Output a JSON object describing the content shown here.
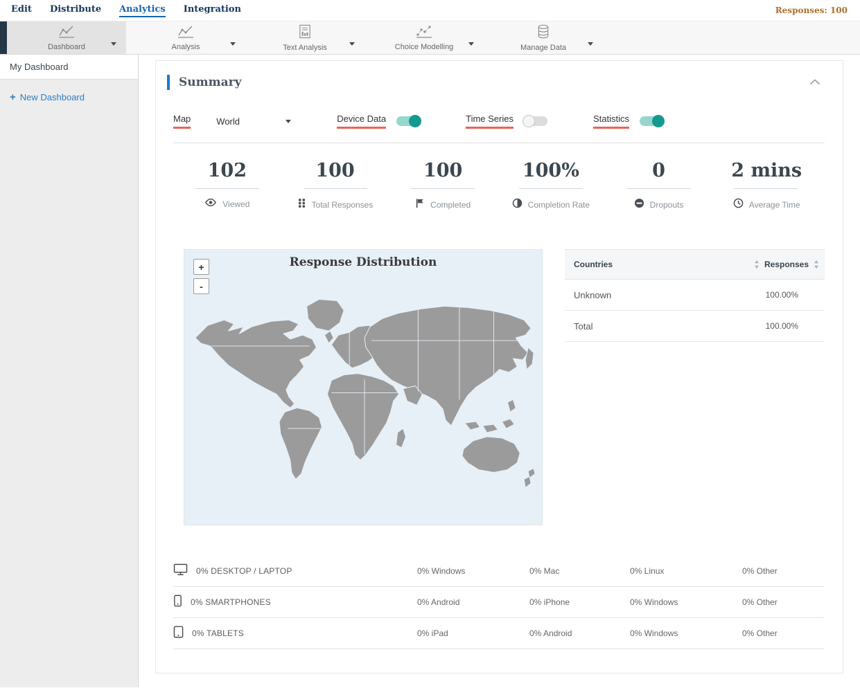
{
  "navbar": {
    "items": [
      {
        "label": "Edit",
        "active": false
      },
      {
        "label": "Distribute",
        "active": false
      },
      {
        "label": "Analytics",
        "active": true
      },
      {
        "label": "Integration",
        "active": false
      }
    ],
    "responses_label": "Responses: 100"
  },
  "toolbar": {
    "items": [
      {
        "label": "Dashboard",
        "icon": "dashboard-chart-icon",
        "active": true
      },
      {
        "label": "Analysis",
        "icon": "analysis-chart-icon",
        "active": false
      },
      {
        "label": "Text Analysis",
        "icon": "text-analysis-icon",
        "active": false
      },
      {
        "label": "Choice Modelling",
        "icon": "choice-modelling-icon",
        "active": false
      },
      {
        "label": "Manage Data",
        "icon": "database-icon",
        "active": false
      }
    ]
  },
  "sidebar": {
    "items": [
      {
        "label": "My Dashboard",
        "active": true
      }
    ],
    "new_dashboard": {
      "plus": "+",
      "label": "New Dashboard"
    }
  },
  "summary": {
    "title": "Summary",
    "controls": {
      "map": {
        "label": "Map",
        "value": "World"
      },
      "device_data": {
        "label": "Device Data",
        "on": true
      },
      "time_series": {
        "label": "Time Series",
        "on": false
      },
      "statistics": {
        "label": "Statistics",
        "on": true
      }
    },
    "stats": [
      {
        "value": "102",
        "label": "Viewed",
        "icon": "eye-icon"
      },
      {
        "value": "100",
        "label": "Total Responses",
        "icon": "grid-dots-icon"
      },
      {
        "value": "100",
        "label": "Completed",
        "icon": "flag-icon"
      },
      {
        "value": "100%",
        "label": "Completion Rate",
        "icon": "half-circle-icon"
      },
      {
        "value": "0",
        "label": "Dropouts",
        "icon": "minus-circle-icon"
      },
      {
        "value": "2 mins",
        "label": "Average Time",
        "icon": "clock-icon"
      }
    ],
    "map": {
      "title": "Response Distribution",
      "zoom_in": "+",
      "zoom_out": "-"
    },
    "countries_table": {
      "col_country": "Countries",
      "col_responses": "Responses",
      "rows": [
        {
          "country": "Unknown",
          "responses": "100.00%"
        },
        {
          "country": "Total",
          "responses": "100.00%"
        }
      ]
    },
    "devices": [
      {
        "icon": "desktop-icon",
        "label": "0% DESKTOP / LAPTOP",
        "cols": [
          "0% Windows",
          "0% Mac",
          "0% Linux",
          "0% Other"
        ]
      },
      {
        "icon": "smartphone-icon",
        "label": "0% SMARTPHONES",
        "cols": [
          "0% Android",
          "0% iPhone",
          "0% Windows",
          "0% Other"
        ]
      },
      {
        "icon": "tablet-icon",
        "label": "0% TABLETS",
        "cols": [
          "0% iPad",
          "0% Android",
          "0% Windows",
          "0% Other"
        ]
      }
    ]
  },
  "colors": {
    "accent_blue": "#1f7ac9",
    "active_nav_blue": "#1467b3",
    "toggle_on_teal": "#14998f",
    "highlight_underline_red": "#ee6352",
    "responses_text": "#a9702d",
    "map_land_gray": "#9b9b9b",
    "map_water_blue": "#e7eff7",
    "toolbar_accent_dark": "#243845"
  }
}
